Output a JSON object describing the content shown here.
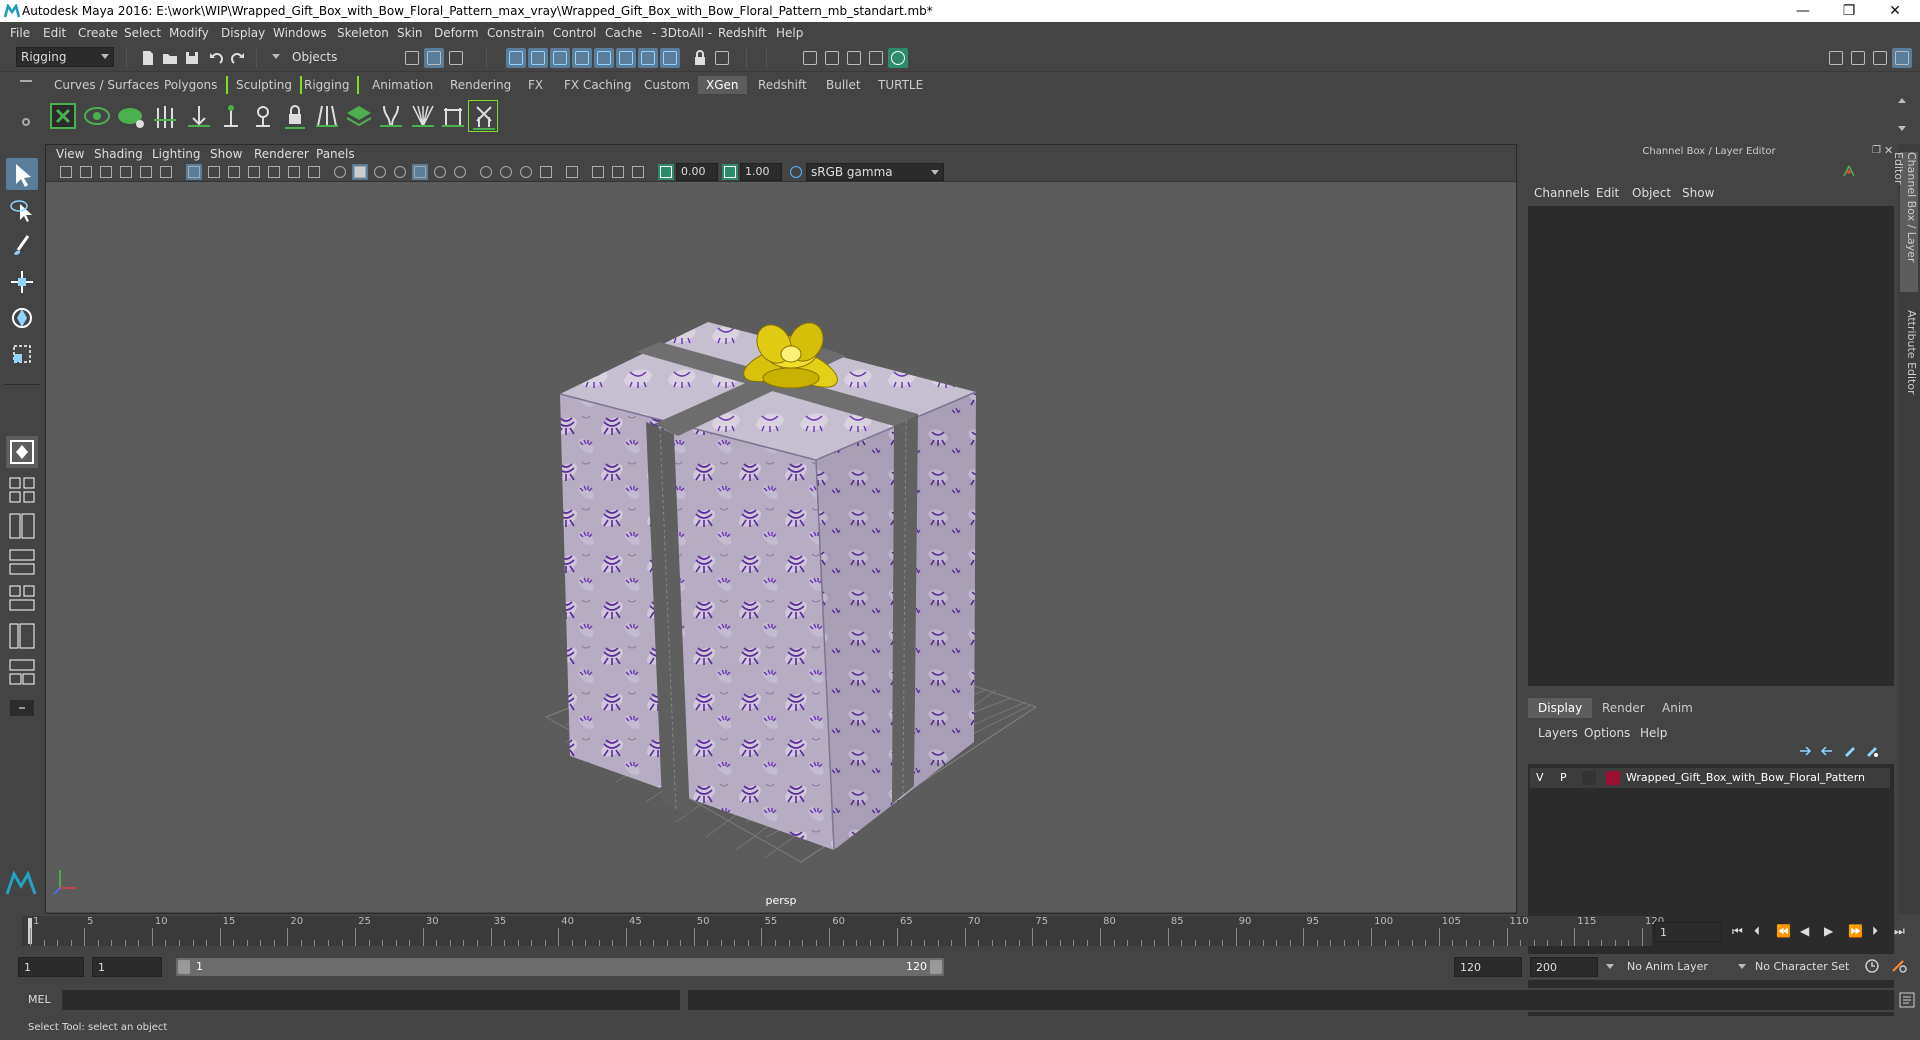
{
  "window": {
    "title": "Autodesk Maya 2016: E:\\work\\WIP\\Wrapped_Gift_Box_with_Bow_Floral_Pattern_max_vray\\Wrapped_Gift_Box_with_Bow_Floral_Pattern_mb_standart.mb*",
    "minimize": "—",
    "restore": "❐",
    "close": "✕"
  },
  "menubar": [
    "File",
    "Edit",
    "Create",
    "Select",
    "Modify",
    "Display",
    "Windows",
    "Skeleton",
    "Skin",
    "Deform",
    "Constrain",
    "Control",
    "Cache",
    "- 3DtoAll -",
    "Redshift",
    "Help"
  ],
  "statusline": {
    "menuset": "Rigging",
    "selection_mode": "Objects"
  },
  "shelf": {
    "tabs": [
      "Curves / Surfaces",
      "Polygons",
      "Sculpting",
      "Rigging",
      "Animation",
      "Rendering",
      "FX",
      "FX Caching",
      "Custom",
      "XGen",
      "Redshift",
      "Bullet",
      "TURTLE"
    ],
    "active_tab": "XGen"
  },
  "viewport": {
    "menus": [
      "View",
      "Shading",
      "Lighting",
      "Show",
      "Renderer",
      "Panels"
    ],
    "exposure": "0.00",
    "gamma": "1.00",
    "color_space": "sRGB gamma",
    "camera": "persp"
  },
  "channel_box": {
    "title": "Channel Box / Layer Editor",
    "menus": [
      "Channels",
      "Edit",
      "Object",
      "Show"
    ],
    "layer_tabs": [
      "Display",
      "Render",
      "Anim"
    ],
    "active_layer_tab": "Display",
    "layer_menus": [
      "Layers",
      "Options",
      "Help"
    ],
    "layer": {
      "visible": "V",
      "playback": "P",
      "name": "Wrapped_Gift_Box_with_Bow_Floral_Pattern",
      "color": "#9b1030"
    },
    "side_tabs": [
      "Channel Box / Layer Editor",
      "Attribute Editor"
    ]
  },
  "timeline": {
    "tick_labels": [
      "1",
      "5",
      "10",
      "15",
      "20",
      "25",
      "30",
      "35",
      "40",
      "45",
      "50",
      "55",
      "60",
      "65",
      "70",
      "75",
      "80",
      "85",
      "90",
      "95",
      "100",
      "105",
      "110",
      "115",
      "120"
    ],
    "current_frame": "1"
  },
  "range": {
    "start": "1",
    "playback_start": "1",
    "slider_start": "1",
    "slider_end": "120",
    "playback_end": "120",
    "end": "200",
    "anim_layer": "No Anim Layer",
    "character_set": "No Character Set"
  },
  "command_line": {
    "label": "MEL"
  },
  "help_line": {
    "text": "Select Tool: select an object"
  },
  "colors": {
    "accent": "#5a7d9a",
    "viewport_bg": "#5c5c5c",
    "panel_bg": "#444444",
    "field_bg": "#2b2b2b"
  }
}
